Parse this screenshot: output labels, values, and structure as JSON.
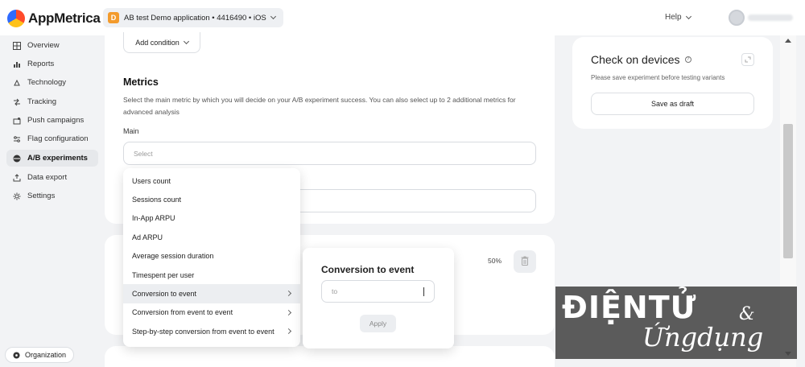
{
  "header": {
    "brand": "AppMetrica",
    "app_badge": "D",
    "app_selector": "AB test Demo application • 4416490 • iOS",
    "help": "Help"
  },
  "sidebar": {
    "items": [
      {
        "label": "Overview",
        "icon": "grid-icon"
      },
      {
        "label": "Reports",
        "icon": "reports-icon"
      },
      {
        "label": "Technology",
        "icon": "technology-icon"
      },
      {
        "label": "Tracking",
        "icon": "tracking-icon"
      },
      {
        "label": "Push campaigns",
        "icon": "push-icon"
      },
      {
        "label": "Flag configuration",
        "icon": "flag-config-icon"
      },
      {
        "label": "A/B experiments",
        "icon": "ab-icon",
        "active": true
      },
      {
        "label": "Data export",
        "icon": "export-icon"
      },
      {
        "label": "Settings",
        "icon": "gear-icon"
      }
    ],
    "organization": "Organization"
  },
  "main": {
    "add_condition": "Add condition",
    "metrics_title": "Metrics",
    "metrics_desc": "Select the main metric by which you will decide on your A/B experiment success. You can also select up to 2 additional metrics for advanced analysis",
    "main_label": "Main",
    "select_placeholder": "Select",
    "percent": "50%"
  },
  "dropdown": {
    "items": [
      {
        "label": "Users count",
        "sub": false
      },
      {
        "label": "Sessions count",
        "sub": false
      },
      {
        "label": "In-App ARPU",
        "sub": false
      },
      {
        "label": "Ad ARPU",
        "sub": false
      },
      {
        "label": "Average session duration",
        "sub": false
      },
      {
        "label": "Timespent per user",
        "sub": false
      },
      {
        "label": "Conversion to event",
        "sub": true,
        "highlighted": true
      },
      {
        "label": "Conversion from event to event",
        "sub": true
      },
      {
        "label": "Step-by-step conversion from event to event",
        "sub": true
      }
    ]
  },
  "submenu": {
    "title": "Conversion to event",
    "input_placeholder": "to",
    "apply": "Apply"
  },
  "right_panel": {
    "title": "Check on devices",
    "note": "Please save experiment before testing variants",
    "save_draft": "Save as draft"
  },
  "watermark": {
    "line1": "ĐIỆNTỬ",
    "amp": "&",
    "line2": "Ứngdụng"
  }
}
